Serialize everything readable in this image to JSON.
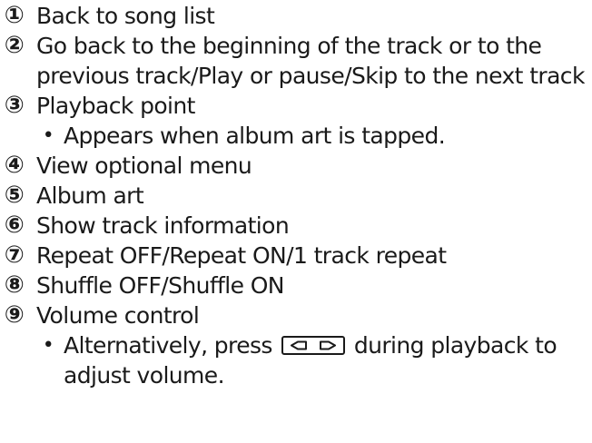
{
  "items": [
    {
      "num": "①",
      "text": "Back to song list"
    },
    {
      "num": "②",
      "text": "Go back to the beginning of the track or to the",
      "text2": "previous track/Play or pause/Skip to the next track"
    },
    {
      "num": "③",
      "text": "Playback point",
      "note": "Appears when album art is tapped."
    },
    {
      "num": "④",
      "text": "View optional menu"
    },
    {
      "num": "⑤",
      "text": "Album art"
    },
    {
      "num": "⑥",
      "text": "Show track information"
    },
    {
      "num": "⑦",
      "text": "Repeat OFF/Repeat ON/1 track repeat"
    },
    {
      "num": "⑧",
      "text": "Shuffle OFF/Shuffle ON"
    },
    {
      "num": "⑨",
      "text": "Volume control",
      "note_before": "Alternatively, press",
      "note_after": "during playback to",
      "note_cont": "adjust volume."
    }
  ],
  "bullet": "•",
  "icons": {
    "volume_key": "volume-down-up-key-icon"
  }
}
